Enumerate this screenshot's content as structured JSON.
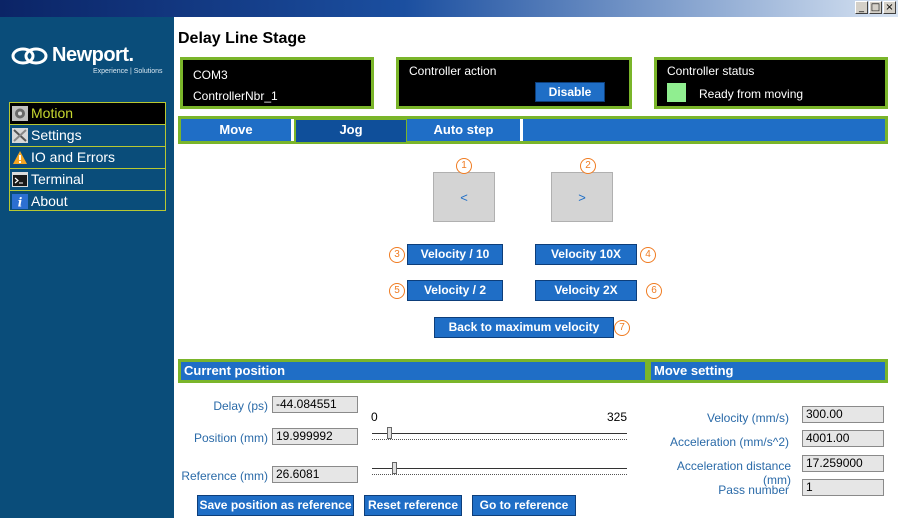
{
  "window": {
    "minimize": "_",
    "maximize": "□",
    "close": "×"
  },
  "brand": {
    "name": "Newport.",
    "tagline": "Experience | Solutions"
  },
  "nav": [
    {
      "label": "Motion",
      "icon": "gear-icon",
      "active": true
    },
    {
      "label": "Settings",
      "icon": "tools-icon",
      "active": false
    },
    {
      "label": "IO and Errors",
      "icon": "warning-icon",
      "active": false
    },
    {
      "label": "Terminal",
      "icon": "terminal-icon",
      "active": false
    },
    {
      "label": "About",
      "icon": "info-icon",
      "active": false
    }
  ],
  "page": {
    "title": "Delay Line Stage"
  },
  "connection": {
    "port": "COM3",
    "controller": "ControllerNbr_1"
  },
  "controller_action": {
    "label": "Controller action",
    "button": "Disable"
  },
  "controller_status": {
    "label": "Controller status",
    "state": "Ready from moving",
    "indicator_color": "#90ee90"
  },
  "tabs": [
    {
      "label": "Move",
      "selected": false
    },
    {
      "label": "Jog",
      "selected": true
    },
    {
      "label": "Auto step",
      "selected": false
    }
  ],
  "jog": {
    "left_arrow": "<",
    "right_arrow": ">",
    "badges": [
      "1",
      "2",
      "3",
      "4",
      "5",
      "6",
      "7"
    ],
    "velocity_div10": "Velocity / 10",
    "velocity_10x": "Velocity 10X",
    "velocity_div2": "Velocity / 2",
    "velocity_2x": "Velocity 2X",
    "back_to_max": "Back to maximum velocity"
  },
  "current_position": {
    "header": "Current position",
    "delay_label": "Delay (ps)",
    "delay_value": "-44.084551",
    "position_label": "Position (mm)",
    "position_value": "19.999992",
    "reference_label": "Reference (mm)",
    "reference_value": "26.6081",
    "slider_min": "0",
    "slider_max": "325",
    "position_fraction": 0.06,
    "reference_fraction": 0.08,
    "save_button": "Save position as reference",
    "reset_button": "Reset reference",
    "goto_button": "Go to reference"
  },
  "move_setting": {
    "header": "Move setting",
    "velocity_label": "Velocity (mm/s)",
    "velocity_value": "300.00",
    "acceleration_label": "Acceleration (mm/s^2)",
    "acceleration_value": "4001.00",
    "accel_distance_label": "Acceleration distance (mm)",
    "accel_distance_value": "17.259000",
    "pass_number_label": "Pass number",
    "pass_number_value": "1"
  },
  "colors": {
    "accent_green": "#7ab52a",
    "button_blue": "#1f6ec6",
    "sidebar": "#0a4d7a",
    "badge_orange": "#f07c22"
  }
}
